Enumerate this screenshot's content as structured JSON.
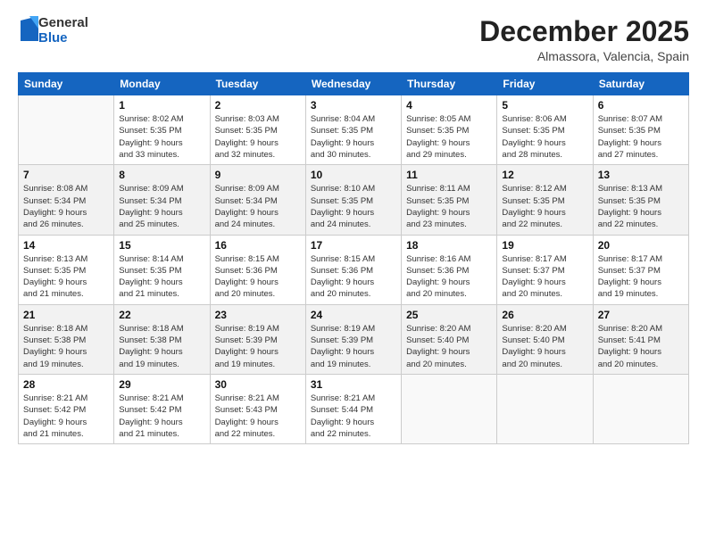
{
  "logo": {
    "general": "General",
    "blue": "Blue"
  },
  "title": "December 2025",
  "subtitle": "Almassora, Valencia, Spain",
  "days_header": [
    "Sunday",
    "Monday",
    "Tuesday",
    "Wednesday",
    "Thursday",
    "Friday",
    "Saturday"
  ],
  "weeks": [
    [
      {
        "day": "",
        "info": ""
      },
      {
        "day": "1",
        "info": "Sunrise: 8:02 AM\nSunset: 5:35 PM\nDaylight: 9 hours\nand 33 minutes."
      },
      {
        "day": "2",
        "info": "Sunrise: 8:03 AM\nSunset: 5:35 PM\nDaylight: 9 hours\nand 32 minutes."
      },
      {
        "day": "3",
        "info": "Sunrise: 8:04 AM\nSunset: 5:35 PM\nDaylight: 9 hours\nand 30 minutes."
      },
      {
        "day": "4",
        "info": "Sunrise: 8:05 AM\nSunset: 5:35 PM\nDaylight: 9 hours\nand 29 minutes."
      },
      {
        "day": "5",
        "info": "Sunrise: 8:06 AM\nSunset: 5:35 PM\nDaylight: 9 hours\nand 28 minutes."
      },
      {
        "day": "6",
        "info": "Sunrise: 8:07 AM\nSunset: 5:35 PM\nDaylight: 9 hours\nand 27 minutes."
      }
    ],
    [
      {
        "day": "7",
        "info": "Sunrise: 8:08 AM\nSunset: 5:34 PM\nDaylight: 9 hours\nand 26 minutes."
      },
      {
        "day": "8",
        "info": "Sunrise: 8:09 AM\nSunset: 5:34 PM\nDaylight: 9 hours\nand 25 minutes."
      },
      {
        "day": "9",
        "info": "Sunrise: 8:09 AM\nSunset: 5:34 PM\nDaylight: 9 hours\nand 24 minutes."
      },
      {
        "day": "10",
        "info": "Sunrise: 8:10 AM\nSunset: 5:35 PM\nDaylight: 9 hours\nand 24 minutes."
      },
      {
        "day": "11",
        "info": "Sunrise: 8:11 AM\nSunset: 5:35 PM\nDaylight: 9 hours\nand 23 minutes."
      },
      {
        "day": "12",
        "info": "Sunrise: 8:12 AM\nSunset: 5:35 PM\nDaylight: 9 hours\nand 22 minutes."
      },
      {
        "day": "13",
        "info": "Sunrise: 8:13 AM\nSunset: 5:35 PM\nDaylight: 9 hours\nand 22 minutes."
      }
    ],
    [
      {
        "day": "14",
        "info": "Sunrise: 8:13 AM\nSunset: 5:35 PM\nDaylight: 9 hours\nand 21 minutes."
      },
      {
        "day": "15",
        "info": "Sunrise: 8:14 AM\nSunset: 5:35 PM\nDaylight: 9 hours\nand 21 minutes."
      },
      {
        "day": "16",
        "info": "Sunrise: 8:15 AM\nSunset: 5:36 PM\nDaylight: 9 hours\nand 20 minutes."
      },
      {
        "day": "17",
        "info": "Sunrise: 8:15 AM\nSunset: 5:36 PM\nDaylight: 9 hours\nand 20 minutes."
      },
      {
        "day": "18",
        "info": "Sunrise: 8:16 AM\nSunset: 5:36 PM\nDaylight: 9 hours\nand 20 minutes."
      },
      {
        "day": "19",
        "info": "Sunrise: 8:17 AM\nSunset: 5:37 PM\nDaylight: 9 hours\nand 20 minutes."
      },
      {
        "day": "20",
        "info": "Sunrise: 8:17 AM\nSunset: 5:37 PM\nDaylight: 9 hours\nand 19 minutes."
      }
    ],
    [
      {
        "day": "21",
        "info": "Sunrise: 8:18 AM\nSunset: 5:38 PM\nDaylight: 9 hours\nand 19 minutes."
      },
      {
        "day": "22",
        "info": "Sunrise: 8:18 AM\nSunset: 5:38 PM\nDaylight: 9 hours\nand 19 minutes."
      },
      {
        "day": "23",
        "info": "Sunrise: 8:19 AM\nSunset: 5:39 PM\nDaylight: 9 hours\nand 19 minutes."
      },
      {
        "day": "24",
        "info": "Sunrise: 8:19 AM\nSunset: 5:39 PM\nDaylight: 9 hours\nand 19 minutes."
      },
      {
        "day": "25",
        "info": "Sunrise: 8:20 AM\nSunset: 5:40 PM\nDaylight: 9 hours\nand 20 minutes."
      },
      {
        "day": "26",
        "info": "Sunrise: 8:20 AM\nSunset: 5:40 PM\nDaylight: 9 hours\nand 20 minutes."
      },
      {
        "day": "27",
        "info": "Sunrise: 8:20 AM\nSunset: 5:41 PM\nDaylight: 9 hours\nand 20 minutes."
      }
    ],
    [
      {
        "day": "28",
        "info": "Sunrise: 8:21 AM\nSunset: 5:42 PM\nDaylight: 9 hours\nand 21 minutes."
      },
      {
        "day": "29",
        "info": "Sunrise: 8:21 AM\nSunset: 5:42 PM\nDaylight: 9 hours\nand 21 minutes."
      },
      {
        "day": "30",
        "info": "Sunrise: 8:21 AM\nSunset: 5:43 PM\nDaylight: 9 hours\nand 22 minutes."
      },
      {
        "day": "31",
        "info": "Sunrise: 8:21 AM\nSunset: 5:44 PM\nDaylight: 9 hours\nand 22 minutes."
      },
      {
        "day": "",
        "info": ""
      },
      {
        "day": "",
        "info": ""
      },
      {
        "day": "",
        "info": ""
      }
    ]
  ],
  "row_shading": [
    false,
    true,
    false,
    true,
    false
  ]
}
